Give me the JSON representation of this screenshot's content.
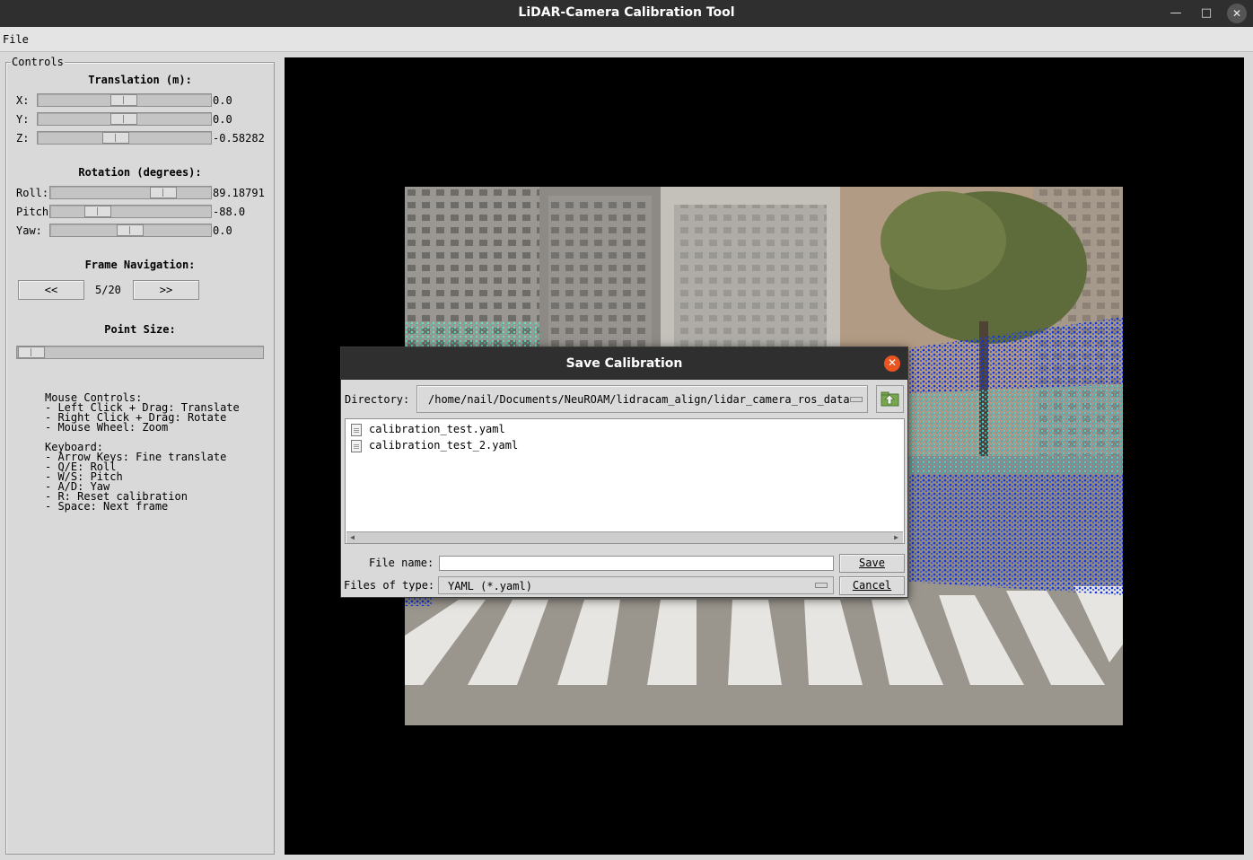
{
  "window": {
    "title": "LiDAR-Camera Calibration Tool"
  },
  "menubar": {
    "file": "File"
  },
  "controls": {
    "legend": "Controls",
    "translation": {
      "heading": "Translation (m):",
      "x": {
        "label": "X:",
        "value": "0.0"
      },
      "y": {
        "label": "Y:",
        "value": "0.0"
      },
      "z": {
        "label": "Z:",
        "value": "-0.58282"
      }
    },
    "rotation": {
      "heading": "Rotation (degrees):",
      "roll": {
        "label": "Roll:",
        "value": "89.18791"
      },
      "pitch": {
        "label": "Pitch",
        "value": "-88.0"
      },
      "yaw": {
        "label": "Yaw:",
        "value": "0.0"
      }
    },
    "navigation": {
      "heading": "Frame Navigation:",
      "prev": "<<",
      "counter": "5/20",
      "next": ">>"
    },
    "point_size": {
      "heading": "Point Size:"
    },
    "help": {
      "mouse": "Mouse Controls:\n- Left Click + Drag: Translate\n- Right Click + Drag: Rotate\n- Mouse Wheel: Zoom",
      "keyboard": "Keyboard:\n- Arrow Keys: Fine translate\n- Q/E: Roll\n- W/S: Pitch\n- A/D: Yaw\n- R: Reset calibration\n- Space: Next frame"
    }
  },
  "dialog": {
    "title": "Save Calibration",
    "directory_label": "Directory:",
    "directory_value": "/home/nail/Documents/NeuROAM/lidracam_align/lidar_camera_ros_data",
    "files": [
      "calibration_test.yaml",
      "calibration_test_2.yaml"
    ],
    "filename_label": "File name:",
    "filename_value": "",
    "filetype_label": "Files of type:",
    "filetype_value": "YAML (*.yaml)",
    "save_button": "Save",
    "cancel_button": "Cancel"
  }
}
